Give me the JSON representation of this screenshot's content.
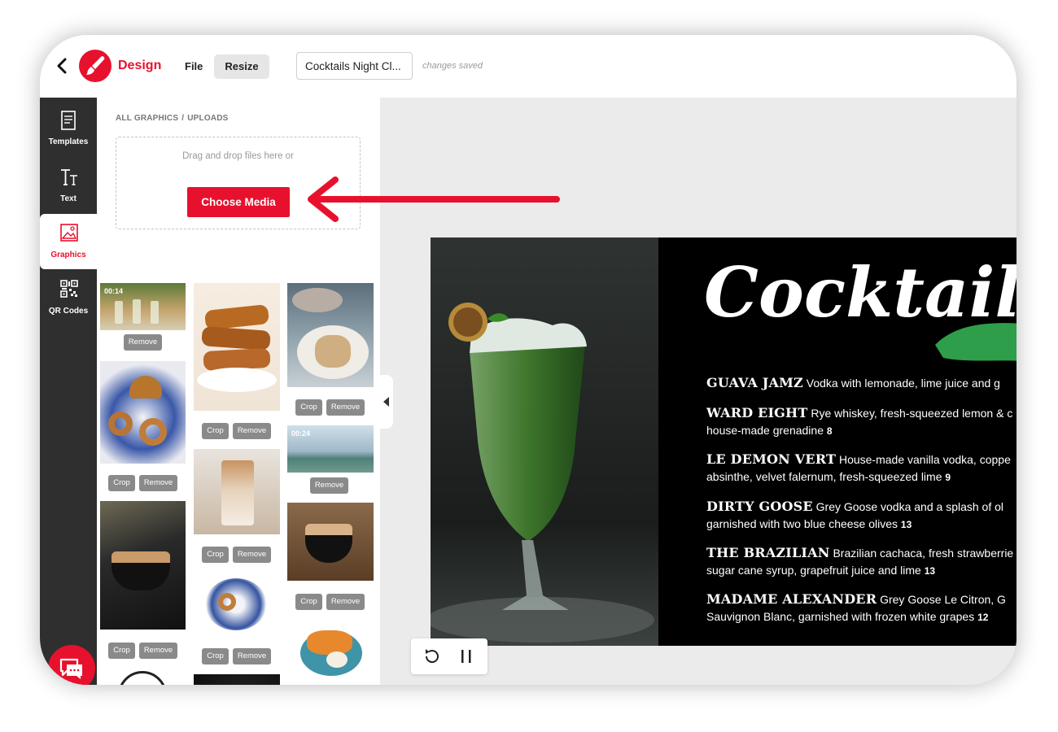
{
  "app": {
    "brand": "Design"
  },
  "topbar": {
    "file_label": "File",
    "resize_label": "Resize",
    "doc_title": "Cocktails Night Cl...",
    "save_status": "changes saved"
  },
  "rail": {
    "items": [
      {
        "label": "Templates",
        "icon": "templates-icon"
      },
      {
        "label": "Text",
        "icon": "text-icon"
      },
      {
        "label": "Graphics",
        "icon": "graphics-icon",
        "active": true
      },
      {
        "label": "QR Codes",
        "icon": "qr-code-icon"
      }
    ]
  },
  "panel": {
    "breadcrumb_root": "ALL GRAPHICS",
    "breadcrumb_sep": "/",
    "breadcrumb_current": "UPLOADS",
    "dropzone_text": "Drag and drop files here or",
    "choose_media_label": "Choose Media",
    "crop_label": "Crop",
    "remove_label": "Remove",
    "video_durations": [
      "00:14",
      "00:24"
    ]
  },
  "canvas": {
    "title": "Cocktails",
    "items": [
      {
        "name": "GUAVA JAMZ",
        "desc": "Vodka with lemonade, lime juice and g",
        "desc2": "",
        "price": ""
      },
      {
        "name": "WARD EIGHT",
        "desc": "Rye whiskey, fresh-squeezed lemon & c",
        "desc2": "house-made grenadine",
        "price": "8"
      },
      {
        "name": "LE DEMON VERT",
        "desc": "House-made vanilla vodka, coppe",
        "desc2": "absinthe, velvet falernum, fresh-squeezed lime",
        "price": "9"
      },
      {
        "name": "DIRTY GOOSE",
        "desc": "Grey Goose vodka and a splash of ol",
        "desc2": "garnished with two blue cheese olives",
        "price": "13"
      },
      {
        "name": "THE BRAZILIAN",
        "desc": "Brazilian cachaca, fresh strawberrie",
        "desc2": "sugar cane syrup, grapefruit juice and lime",
        "price": "13"
      },
      {
        "name": "MADAME ALEXANDER",
        "desc": "Grey Goose Le Citron, G",
        "desc2": "Sauvignon Blanc, garnished with frozen white grapes",
        "price": "12"
      }
    ]
  },
  "colors": {
    "brand": "#e8112d",
    "rail": "#2f2f2f",
    "button_grey": "#8a8a8a"
  },
  "icons": {
    "back": "chevron-left-icon",
    "chat": "chat-icon",
    "replay": "replay-icon",
    "pause": "pause-icon",
    "collapse": "collapse-left-icon"
  }
}
